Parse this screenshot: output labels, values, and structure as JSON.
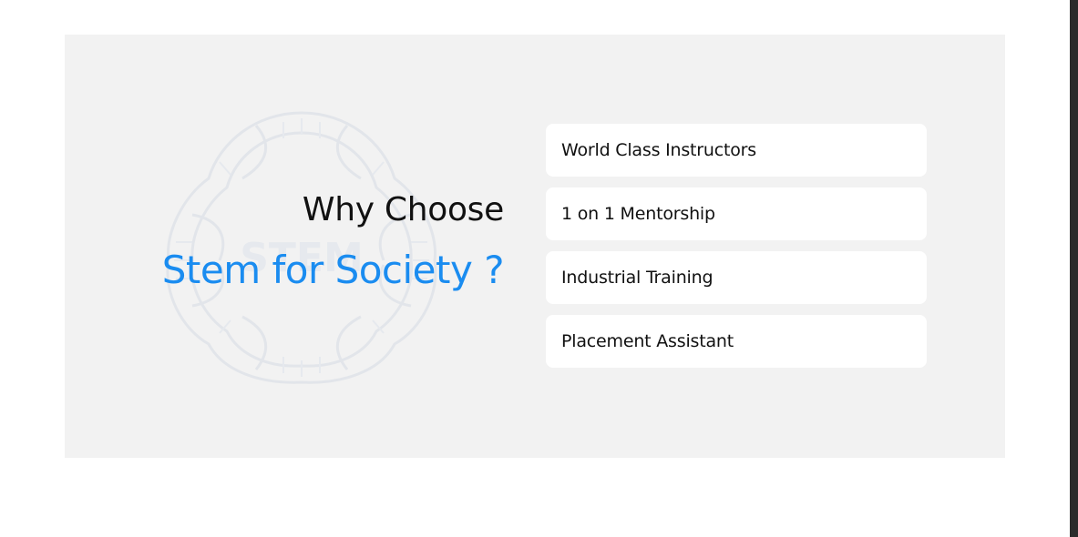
{
  "section": {
    "heading_line1": "Why Choose",
    "heading_line2": "Stem for Society ?",
    "watermark_text": "STEM"
  },
  "features": [
    {
      "label": "World Class Instructors"
    },
    {
      "label": "1 on 1 Mentorship"
    },
    {
      "label": "Industrial Training"
    },
    {
      "label": "Placement Assistant"
    }
  ],
  "colors": {
    "panel_background": "#f2f2f2",
    "accent_blue": "#1a8cf0",
    "card_background": "#ffffff",
    "text_dark": "#111111"
  }
}
